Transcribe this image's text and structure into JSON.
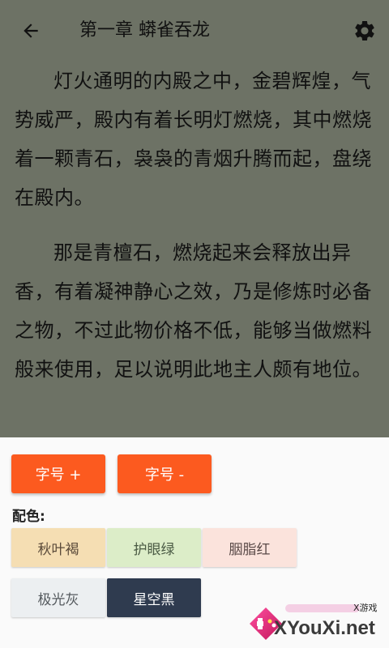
{
  "header": {
    "back_icon": "arrow-left-icon",
    "title": "第一章 蟒雀吞龙",
    "settings_icon": "gear-icon"
  },
  "content": {
    "background": "#6d7265",
    "paragraphs": [
      "灯火通明的内殿之中，金碧辉煌，气势威严，殿内有着长明灯燃烧，其中燃烧着一颗青石，袅袅的青烟升腾而起，盘绕在殿内。",
      "那是青檀石，燃烧起来会释放出异香，有着凝神静心之效，乃是修炼时必备之物，不过此物价格不低，能够当做燃料般来使用，足以说明此地主人颇有地位。"
    ]
  },
  "settings_panel": {
    "font_increase_label": "字号 +",
    "font_decrease_label": "字号 -",
    "button_color": "#fc5a1f",
    "color_scheme_label": "配色:",
    "themes": [
      {
        "label": "秋叶褐",
        "bg": "#f5deb3",
        "fg": "#5a4a3a"
      },
      {
        "label": "护眼绿",
        "bg": "#dcedc8",
        "fg": "#4a5a44"
      },
      {
        "label": "胭脂红",
        "bg": "#fbe3dc",
        "fg": "#5a4a48"
      },
      {
        "label": "极光灰",
        "bg": "#eceff1",
        "fg": "#555a5e"
      },
      {
        "label": "星空黑",
        "bg": "#2f3b4f",
        "fg": "#ffffff"
      }
    ]
  },
  "watermark": {
    "tag": "X游戏",
    "site": "XYouXi.net"
  }
}
